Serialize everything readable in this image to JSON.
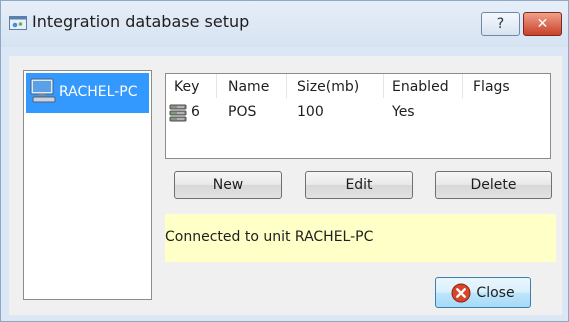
{
  "window": {
    "title": "Integration database setup",
    "help_glyph": "?",
    "close_glyph": "✕"
  },
  "units": [
    {
      "label": "RACHEL-PC",
      "icon": "computer-icon",
      "selected": true
    }
  ],
  "table": {
    "columns": [
      "Key",
      "Name",
      "Size(mb)",
      "Enabled",
      "Flags"
    ],
    "rows": [
      {
        "key": "6",
        "name": "POS",
        "size": "100",
        "enabled": "Yes",
        "flags": "",
        "icon": "database-icon"
      }
    ]
  },
  "buttons": {
    "new": "New",
    "edit": "Edit",
    "delete": "Delete",
    "close": "Close"
  },
  "status": {
    "message": "Connected to unit RACHEL-PC"
  },
  "colors": {
    "selection": "#3399ff",
    "status_background": "#ffffc8",
    "close_accent": "#c9412a"
  }
}
